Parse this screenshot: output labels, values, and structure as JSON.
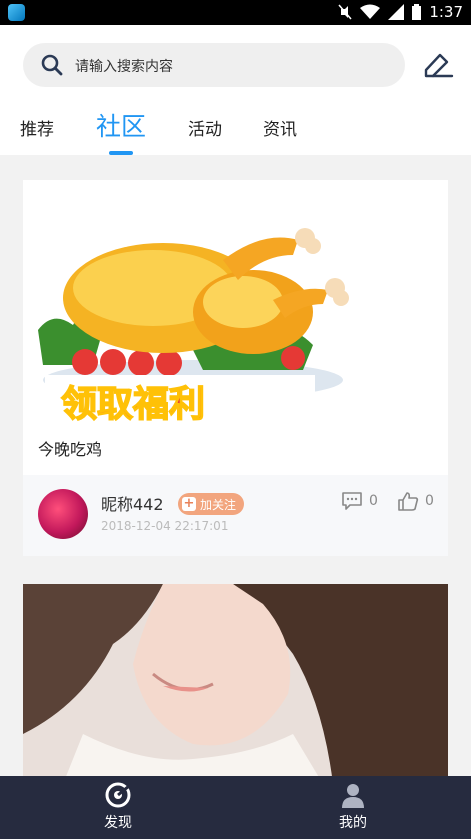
{
  "status_bar": {
    "time": "1:37"
  },
  "search": {
    "placeholder": "请输入搜索内容"
  },
  "tabs": [
    {
      "label": "推荐",
      "active": false
    },
    {
      "label": "社区",
      "active": true
    },
    {
      "label": "活动",
      "active": false
    },
    {
      "label": "资讯",
      "active": false
    }
  ],
  "posts": [
    {
      "image_text": "领取福利",
      "title": "今晚吃鸡",
      "nickname": "昵称442",
      "follow_label": "加关注",
      "date": "2018-12-04 22:17:01",
      "comments": "0",
      "likes": "0"
    }
  ],
  "bottom_nav": [
    {
      "label": "发现",
      "icon": "discover-icon"
    },
    {
      "label": "我的",
      "icon": "profile-icon"
    }
  ],
  "colors": {
    "accent": "#2196f3",
    "nav_bg": "#262b3f",
    "follow_bg": "#f2a57e"
  }
}
